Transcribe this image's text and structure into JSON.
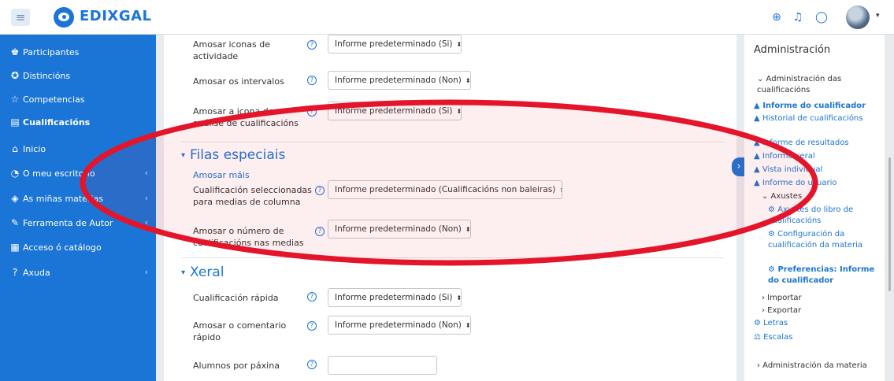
{
  "header": {
    "menu_icon": "hamburger-icon",
    "brand": "EDIXGAL",
    "icons": [
      "globe-icon",
      "bell-icon",
      "chat-icon"
    ],
    "caret": "▾"
  },
  "sidebar": {
    "items": [
      {
        "icon": "participants-icon",
        "glyph": "♚",
        "label": "Participantes"
      },
      {
        "icon": "badge-icon",
        "glyph": "✪",
        "label": "Distincións"
      },
      {
        "icon": "star-icon",
        "glyph": "☆",
        "label": "Competencias"
      },
      {
        "icon": "grades-icon",
        "glyph": "▤",
        "label": "Cualificacións"
      },
      {
        "icon": "home-icon",
        "glyph": "⌂",
        "label": "Inicio"
      },
      {
        "icon": "dashboard-icon",
        "glyph": "◔",
        "label": "O meu escritorio"
      },
      {
        "icon": "courses-icon",
        "glyph": "◈",
        "label": "As miñas materias"
      },
      {
        "icon": "pencil-icon",
        "glyph": "✎",
        "label": "Ferramenta de Autor"
      },
      {
        "icon": "catalog-icon",
        "glyph": "▦",
        "label": "Acceso ó catálogo"
      },
      {
        "icon": "help-icon",
        "glyph": "?",
        "label": "Axuda"
      }
    ]
  },
  "main": {
    "rows_top": [
      {
        "label": "Amosar iconas de actividade",
        "value": "Informe predeterminado (Si)"
      },
      {
        "label": "Amosar os intervalos",
        "value": "Informe predeterminado (Non)"
      },
      {
        "label": "Amosar a icona de análise de cualificacións",
        "value": "Informe predeterminado (Si)"
      }
    ],
    "section1": {
      "title": "Filas especiais",
      "show_more": "Amosar máis",
      "rows": [
        {
          "label": "Cualificación seleccionadas para medias de columna",
          "value": "Informe predeterminado (Cualificacións non baleiras)"
        },
        {
          "label": "Amosar o número de cualificacións nas medias",
          "value": "Informe predeterminado (Non)"
        }
      ]
    },
    "section2": {
      "title": "Xeral",
      "rows": [
        {
          "label": "Cualificación rápida",
          "value": "Informe predeterminado (Si)"
        },
        {
          "label": "Amosar o comentario rápido",
          "value": "Informe predeterminado (Non)"
        },
        {
          "label": "Alumnos por páxina",
          "value": ""
        }
      ]
    },
    "help_glyph": "?",
    "select_arrow": "⬍",
    "twisty": "▾"
  },
  "drawer": {
    "title": "Administración",
    "items": [
      {
        "text": "⌄ Administración das cualificacións",
        "style": "plain"
      },
      {
        "text": "Informe do cualificador",
        "style": "link-bold"
      },
      {
        "text": "Historial de cualificacións",
        "style": "link"
      },
      {
        "text": "Informe de resultados",
        "style": "link"
      },
      {
        "text": "Informe xeral",
        "style": "link"
      },
      {
        "text": "Vista individual",
        "style": "link"
      },
      {
        "text": "Informe do usuario",
        "style": "link"
      },
      {
        "text": "⌄ Axustes",
        "style": "plain"
      },
      {
        "text": "Axustes do libro de cualificacións",
        "style": "link"
      },
      {
        "text": "Configuración da cualificación da materia",
        "style": "link"
      },
      {
        "text": "Preferencias: Informe do cualificador",
        "style": "link-bold"
      },
      {
        "text": "› Importar",
        "style": "plain"
      },
      {
        "text": "› Exportar",
        "style": "plain"
      },
      {
        "text": "Letras",
        "style": "link"
      },
      {
        "text": "Escalas",
        "style": "link"
      },
      {
        "text": "› Administración da materia",
        "style": "plain"
      }
    ]
  },
  "colors": {
    "primary": "#1b75d6",
    "highlight": "#e4152b"
  }
}
